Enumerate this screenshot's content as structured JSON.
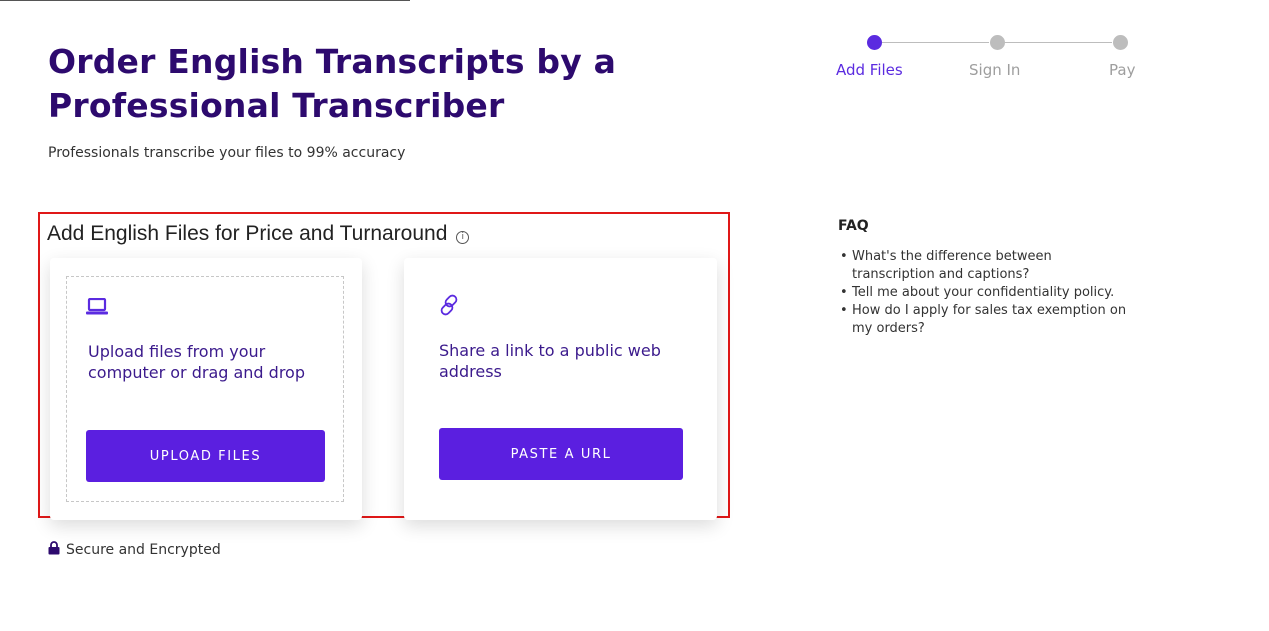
{
  "hero": {
    "title_line1": "Order English Transcripts by a",
    "title_line2": "Professional Transcriber",
    "subtitle": "Professionals transcribe your files to 99% accuracy"
  },
  "stepper": {
    "steps": [
      {
        "label": "Add Files",
        "active": true
      },
      {
        "label": "Sign In",
        "active": false
      },
      {
        "label": "Pay",
        "active": false
      }
    ],
    "active_color": "#5b2be0",
    "inactive_color": "#bdbdbd"
  },
  "add_files": {
    "title": "Add English Files for Price and Turnaround",
    "info_icon": "i",
    "upload_card": {
      "icon": "laptop-icon",
      "text_line1": "Upload files from your",
      "text_line2": "computer or drag and drop",
      "button_label": "UPLOAD FILES"
    },
    "url_card": {
      "icon": "link-icon",
      "text_line1": "Share a link to a public web",
      "text_line2": "address",
      "button_label": "PASTE A URL"
    }
  },
  "secure": {
    "icon": "lock-icon",
    "label": "Secure and Encrypted"
  },
  "faq": {
    "title": "FAQ",
    "items": [
      {
        "line1": "What's the difference between",
        "line2": "transcription and captions?"
      },
      {
        "line1": "Tell me about your confidentiality policy.",
        "line2": ""
      },
      {
        "line1": "How do I apply for sales tax exemption on",
        "line2": "my orders?"
      }
    ]
  },
  "colors": {
    "brand_dark": "#2d0a6e",
    "accent": "#5b1fe0",
    "highlight_border": "#e01818"
  }
}
